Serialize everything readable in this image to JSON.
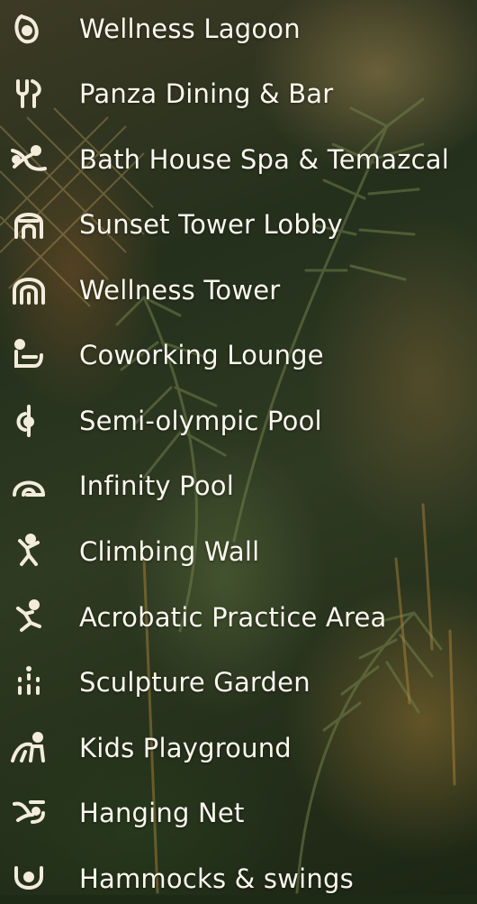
{
  "colors": {
    "text": "#fbf7ee",
    "icon": "#f3ecdc"
  },
  "amenities": [
    {
      "label": "Wellness Lagoon",
      "icon": "lagoon-icon"
    },
    {
      "label": "Panza Dining & Bar",
      "icon": "dining-icon"
    },
    {
      "label": "Bath House Spa & Temazcal",
      "icon": "spa-icon"
    },
    {
      "label": "Sunset Tower Lobby",
      "icon": "tower-lobby-icon"
    },
    {
      "label": "Wellness Tower",
      "icon": "wellness-tower-icon"
    },
    {
      "label": "Coworking Lounge",
      "icon": "coworking-icon"
    },
    {
      "label": "Semi-olympic Pool",
      "icon": "pool-icon"
    },
    {
      "label": "Infinity Pool",
      "icon": "infinity-pool-icon"
    },
    {
      "label": "Climbing Wall",
      "icon": "climbing-icon"
    },
    {
      "label": "Acrobatic Practice Area",
      "icon": "acrobatic-icon"
    },
    {
      "label": "Sculpture Garden",
      "icon": "sculpture-icon"
    },
    {
      "label": "Kids Playground",
      "icon": "playground-icon"
    },
    {
      "label": "Hanging Net",
      "icon": "hanging-net-icon"
    },
    {
      "label": "Hammocks & swings",
      "icon": "hammock-icon"
    }
  ]
}
